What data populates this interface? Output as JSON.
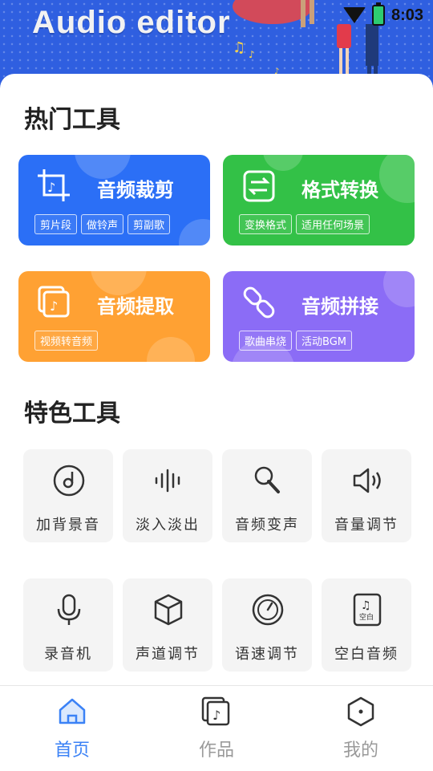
{
  "banner": {
    "title": "Audio editor"
  },
  "status_bar": {
    "time": "8:03"
  },
  "hot_tools": {
    "title": "热门工具",
    "cards": [
      {
        "title": "音频裁剪",
        "icon": "crop-audio-icon",
        "color": "#2b6ff6",
        "tags": [
          "剪片段",
          "做铃声",
          "剪副歌"
        ]
      },
      {
        "title": "格式转换",
        "icon": "convert-icon",
        "color": "#33c147",
        "tags": [
          "变换格式",
          "适用任何场景"
        ]
      },
      {
        "title": "音频提取",
        "icon": "extract-audio-icon",
        "color": "#ffa133",
        "tags": [
          "视频转音频"
        ]
      },
      {
        "title": "音频拼接",
        "icon": "link-icon",
        "color": "#8b6cf6",
        "tags": [
          "歌曲串烧",
          "活动BGM"
        ]
      }
    ]
  },
  "feature_tools": {
    "title": "特色工具",
    "items": [
      {
        "label": "加背景音",
        "icon": "music-disc-icon"
      },
      {
        "label": "淡入淡出",
        "icon": "waveform-icon"
      },
      {
        "label": "音频变声",
        "icon": "voice-changer-icon"
      },
      {
        "label": "音量调节",
        "icon": "speaker-icon"
      },
      {
        "label": "录音机",
        "icon": "microphone-icon"
      },
      {
        "label": "声道调节",
        "icon": "cube-icon"
      },
      {
        "label": "语速调节",
        "icon": "gauge-icon"
      },
      {
        "label": "空白音频",
        "icon": "blank-audio-icon",
        "icon_text": "空白"
      }
    ]
  },
  "bottom_nav": {
    "items": [
      {
        "label": "首页",
        "icon": "home-icon",
        "active": true
      },
      {
        "label": "作品",
        "icon": "works-icon",
        "active": false
      },
      {
        "label": "我的",
        "icon": "profile-hexagon-icon",
        "active": false
      }
    ]
  },
  "colors": {
    "accent": "#3b82f6",
    "inactive": "#9a9a9a"
  }
}
